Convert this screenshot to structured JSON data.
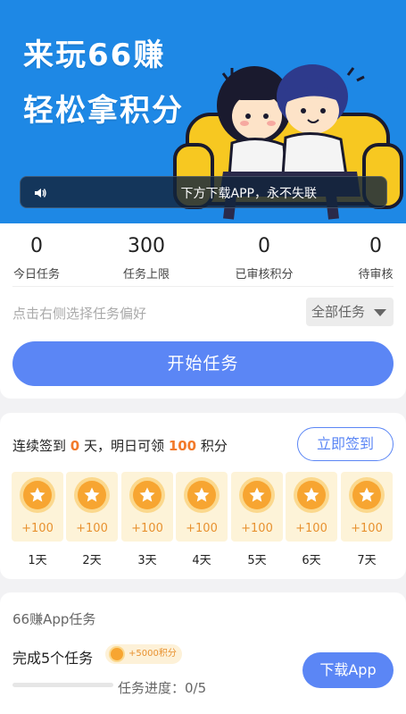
{
  "banner": {
    "title_line1": "来玩66赚",
    "title_line2": "轻松拿积分",
    "notice": "下方下载APP，永不失联",
    "bg_color": "#1e88e5"
  },
  "stats": [
    {
      "value": "0",
      "label": "今日任务"
    },
    {
      "value": "300",
      "label": "任务上限"
    },
    {
      "value": "0",
      "label": "已审核积分"
    },
    {
      "value": "0",
      "label": "待审核"
    }
  ],
  "preference": {
    "hint": "点击右侧选择任务偏好",
    "filter_selected": "全部任务"
  },
  "start_button": "开始任务",
  "signin": {
    "prefix": "连续签到",
    "days_count": "0",
    "middle": "天，明日可领",
    "points": "100",
    "suffix": "积分",
    "button": "立即签到",
    "days": [
      {
        "points": "+100",
        "label": "1天"
      },
      {
        "points": "+100",
        "label": "2天"
      },
      {
        "points": "+100",
        "label": "3天"
      },
      {
        "points": "+100",
        "label": "4天"
      },
      {
        "points": "+100",
        "label": "5天"
      },
      {
        "points": "+100",
        "label": "6天"
      },
      {
        "points": "+100",
        "label": "7天"
      }
    ]
  },
  "app_task": {
    "section_title": "66赚App任务",
    "task_name": "完成5个任务",
    "badge": "+5000积分",
    "progress_label": "任务进度：0/5",
    "progress_fraction": 0,
    "button": "下载App"
  },
  "colors": {
    "accent": "#5b86f5",
    "highlight": "#f27a2a",
    "coin": "#f7a531"
  }
}
